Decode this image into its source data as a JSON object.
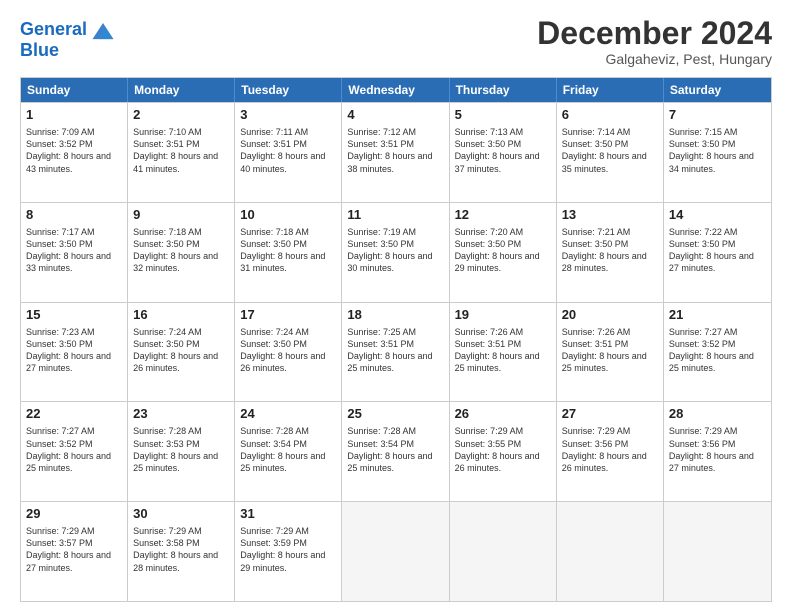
{
  "header": {
    "logo_line1": "General",
    "logo_line2": "Blue",
    "main_title": "December 2024",
    "subtitle": "Galgaheviz, Pest, Hungary"
  },
  "days_of_week": [
    "Sunday",
    "Monday",
    "Tuesday",
    "Wednesday",
    "Thursday",
    "Friday",
    "Saturday"
  ],
  "weeks": [
    [
      {
        "day": 1,
        "sunrise": "7:09 AM",
        "sunset": "3:52 PM",
        "daylight": "8 hours and 43 minutes."
      },
      {
        "day": 2,
        "sunrise": "7:10 AM",
        "sunset": "3:51 PM",
        "daylight": "8 hours and 41 minutes."
      },
      {
        "day": 3,
        "sunrise": "7:11 AM",
        "sunset": "3:51 PM",
        "daylight": "8 hours and 40 minutes."
      },
      {
        "day": 4,
        "sunrise": "7:12 AM",
        "sunset": "3:51 PM",
        "daylight": "8 hours and 38 minutes."
      },
      {
        "day": 5,
        "sunrise": "7:13 AM",
        "sunset": "3:50 PM",
        "daylight": "8 hours and 37 minutes."
      },
      {
        "day": 6,
        "sunrise": "7:14 AM",
        "sunset": "3:50 PM",
        "daylight": "8 hours and 35 minutes."
      },
      {
        "day": 7,
        "sunrise": "7:15 AM",
        "sunset": "3:50 PM",
        "daylight": "8 hours and 34 minutes."
      }
    ],
    [
      {
        "day": 8,
        "sunrise": "7:17 AM",
        "sunset": "3:50 PM",
        "daylight": "8 hours and 33 minutes."
      },
      {
        "day": 9,
        "sunrise": "7:18 AM",
        "sunset": "3:50 PM",
        "daylight": "8 hours and 32 minutes."
      },
      {
        "day": 10,
        "sunrise": "7:18 AM",
        "sunset": "3:50 PM",
        "daylight": "8 hours and 31 minutes."
      },
      {
        "day": 11,
        "sunrise": "7:19 AM",
        "sunset": "3:50 PM",
        "daylight": "8 hours and 30 minutes."
      },
      {
        "day": 12,
        "sunrise": "7:20 AM",
        "sunset": "3:50 PM",
        "daylight": "8 hours and 29 minutes."
      },
      {
        "day": 13,
        "sunrise": "7:21 AM",
        "sunset": "3:50 PM",
        "daylight": "8 hours and 28 minutes."
      },
      {
        "day": 14,
        "sunrise": "7:22 AM",
        "sunset": "3:50 PM",
        "daylight": "8 hours and 27 minutes."
      }
    ],
    [
      {
        "day": 15,
        "sunrise": "7:23 AM",
        "sunset": "3:50 PM",
        "daylight": "8 hours and 27 minutes."
      },
      {
        "day": 16,
        "sunrise": "7:24 AM",
        "sunset": "3:50 PM",
        "daylight": "8 hours and 26 minutes."
      },
      {
        "day": 17,
        "sunrise": "7:24 AM",
        "sunset": "3:50 PM",
        "daylight": "8 hours and 26 minutes."
      },
      {
        "day": 18,
        "sunrise": "7:25 AM",
        "sunset": "3:51 PM",
        "daylight": "8 hours and 25 minutes."
      },
      {
        "day": 19,
        "sunrise": "7:26 AM",
        "sunset": "3:51 PM",
        "daylight": "8 hours and 25 minutes."
      },
      {
        "day": 20,
        "sunrise": "7:26 AM",
        "sunset": "3:51 PM",
        "daylight": "8 hours and 25 minutes."
      },
      {
        "day": 21,
        "sunrise": "7:27 AM",
        "sunset": "3:52 PM",
        "daylight": "8 hours and 25 minutes."
      }
    ],
    [
      {
        "day": 22,
        "sunrise": "7:27 AM",
        "sunset": "3:52 PM",
        "daylight": "8 hours and 25 minutes."
      },
      {
        "day": 23,
        "sunrise": "7:28 AM",
        "sunset": "3:53 PM",
        "daylight": "8 hours and 25 minutes."
      },
      {
        "day": 24,
        "sunrise": "7:28 AM",
        "sunset": "3:54 PM",
        "daylight": "8 hours and 25 minutes."
      },
      {
        "day": 25,
        "sunrise": "7:28 AM",
        "sunset": "3:54 PM",
        "daylight": "8 hours and 25 minutes."
      },
      {
        "day": 26,
        "sunrise": "7:29 AM",
        "sunset": "3:55 PM",
        "daylight": "8 hours and 26 minutes."
      },
      {
        "day": 27,
        "sunrise": "7:29 AM",
        "sunset": "3:56 PM",
        "daylight": "8 hours and 26 minutes."
      },
      {
        "day": 28,
        "sunrise": "7:29 AM",
        "sunset": "3:56 PM",
        "daylight": "8 hours and 27 minutes."
      }
    ],
    [
      {
        "day": 29,
        "sunrise": "7:29 AM",
        "sunset": "3:57 PM",
        "daylight": "8 hours and 27 minutes."
      },
      {
        "day": 30,
        "sunrise": "7:29 AM",
        "sunset": "3:58 PM",
        "daylight": "8 hours and 28 minutes."
      },
      {
        "day": 31,
        "sunrise": "7:29 AM",
        "sunset": "3:59 PM",
        "daylight": "8 hours and 29 minutes."
      },
      null,
      null,
      null,
      null
    ]
  ]
}
